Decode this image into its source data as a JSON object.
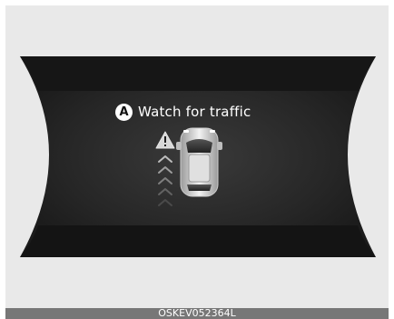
{
  "display": {
    "badge_letter": "A",
    "message": "Watch for traffic",
    "icons": [
      "warning-triangle-icon",
      "car-topview-icon",
      "approach-chevrons-icon"
    ]
  },
  "caption": {
    "code": "OSKEV052364L"
  },
  "colors": {
    "panel": "#1e1e1e",
    "background": "#e9e9e9",
    "caption_bar": "#777777",
    "text": "#ffffff"
  }
}
